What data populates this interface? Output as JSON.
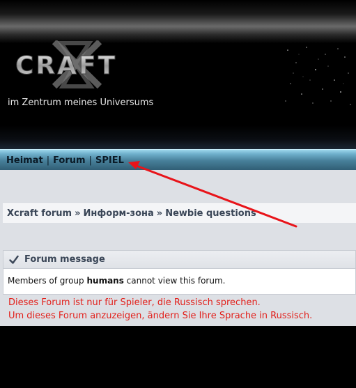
{
  "header": {
    "logo_text": "CRAFT",
    "tagline": "im Zentrum meines Universums"
  },
  "nav": {
    "items": [
      "Heimat",
      "Forum",
      "SPIEL"
    ],
    "separator": "|"
  },
  "breadcrumb": {
    "items": [
      "Xcraft forum",
      "Информ-зона",
      "Newbie questions"
    ],
    "separator": "»"
  },
  "message": {
    "title": "Forum message",
    "text_before": "Members of group ",
    "group": "humans",
    "text_after": " cannot view this forum."
  },
  "warning": {
    "line1": "Dieses Forum ist nur für Spieler, die Russisch sprechen.",
    "line2": "Um dieses Forum anzuzeigen, ändern Sie Ihre Sprache in Russisch."
  },
  "colors": {
    "nav_bar": "#6fb0cc",
    "warning_text": "#e2201b",
    "arrow": "#e8141a"
  }
}
